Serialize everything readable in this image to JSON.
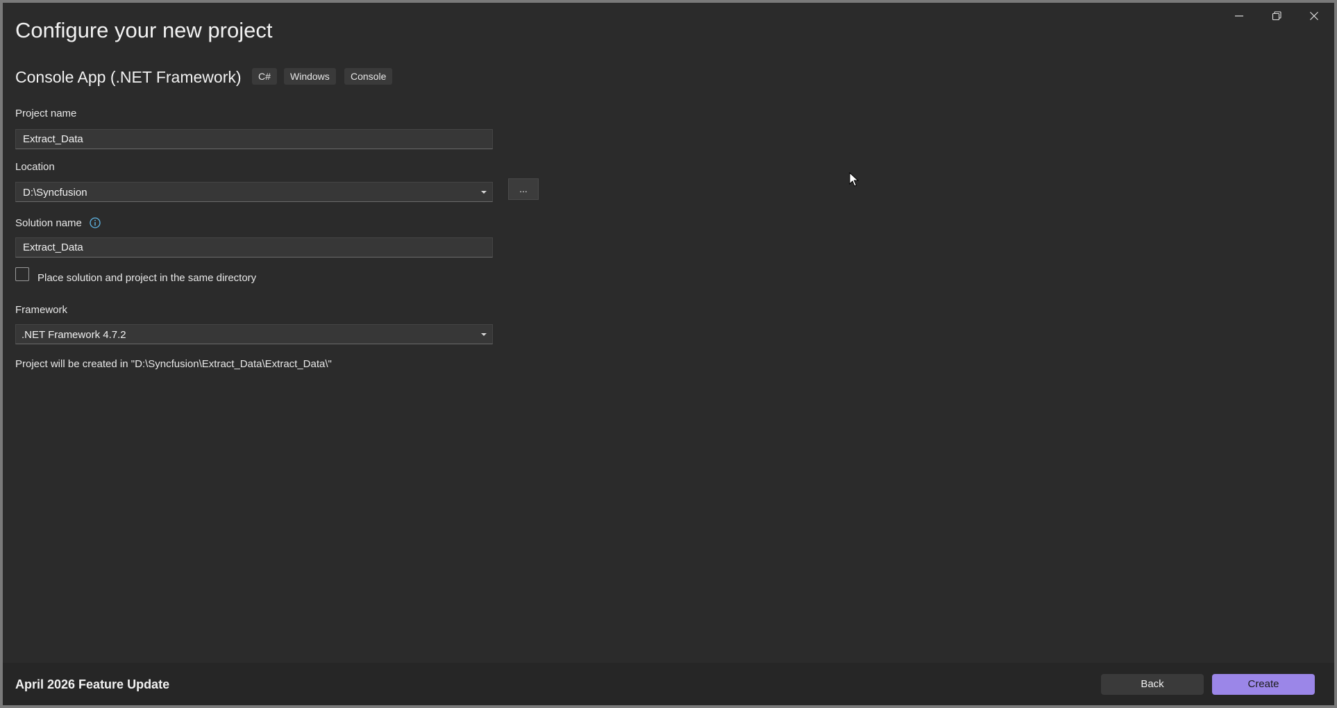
{
  "window": {
    "minimize_icon": "minimize-icon",
    "restore_icon": "restore-icon",
    "close_icon": "close-icon"
  },
  "title": "Configure your new project",
  "template": {
    "name": "Console App (.NET Framework)",
    "tags": [
      "C#",
      "Windows",
      "Console"
    ]
  },
  "project_name": {
    "label": "Project name",
    "value": "Extract_Data"
  },
  "location": {
    "label": "Location",
    "value": "D:\\Syncfusion",
    "browse_label": "..."
  },
  "solution_name": {
    "label": "Solution name",
    "info_icon": "info-icon",
    "value": "Extract_Data"
  },
  "same_directory": {
    "label": "Place solution and project in the same directory",
    "checked": false
  },
  "framework": {
    "label": "Framework",
    "value": ".NET Framework 4.7.2"
  },
  "creation_path": "Project will be created in \"D:\\Syncfusion\\Extract_Data\\Extract_Data\\\"",
  "footer": {
    "edition": "April 2026 Feature Update",
    "back_label": "Back",
    "create_label": "Create"
  },
  "colors": {
    "background": "#2b2b2b",
    "accent": "#9b86e8",
    "info": "#60b8e8"
  }
}
